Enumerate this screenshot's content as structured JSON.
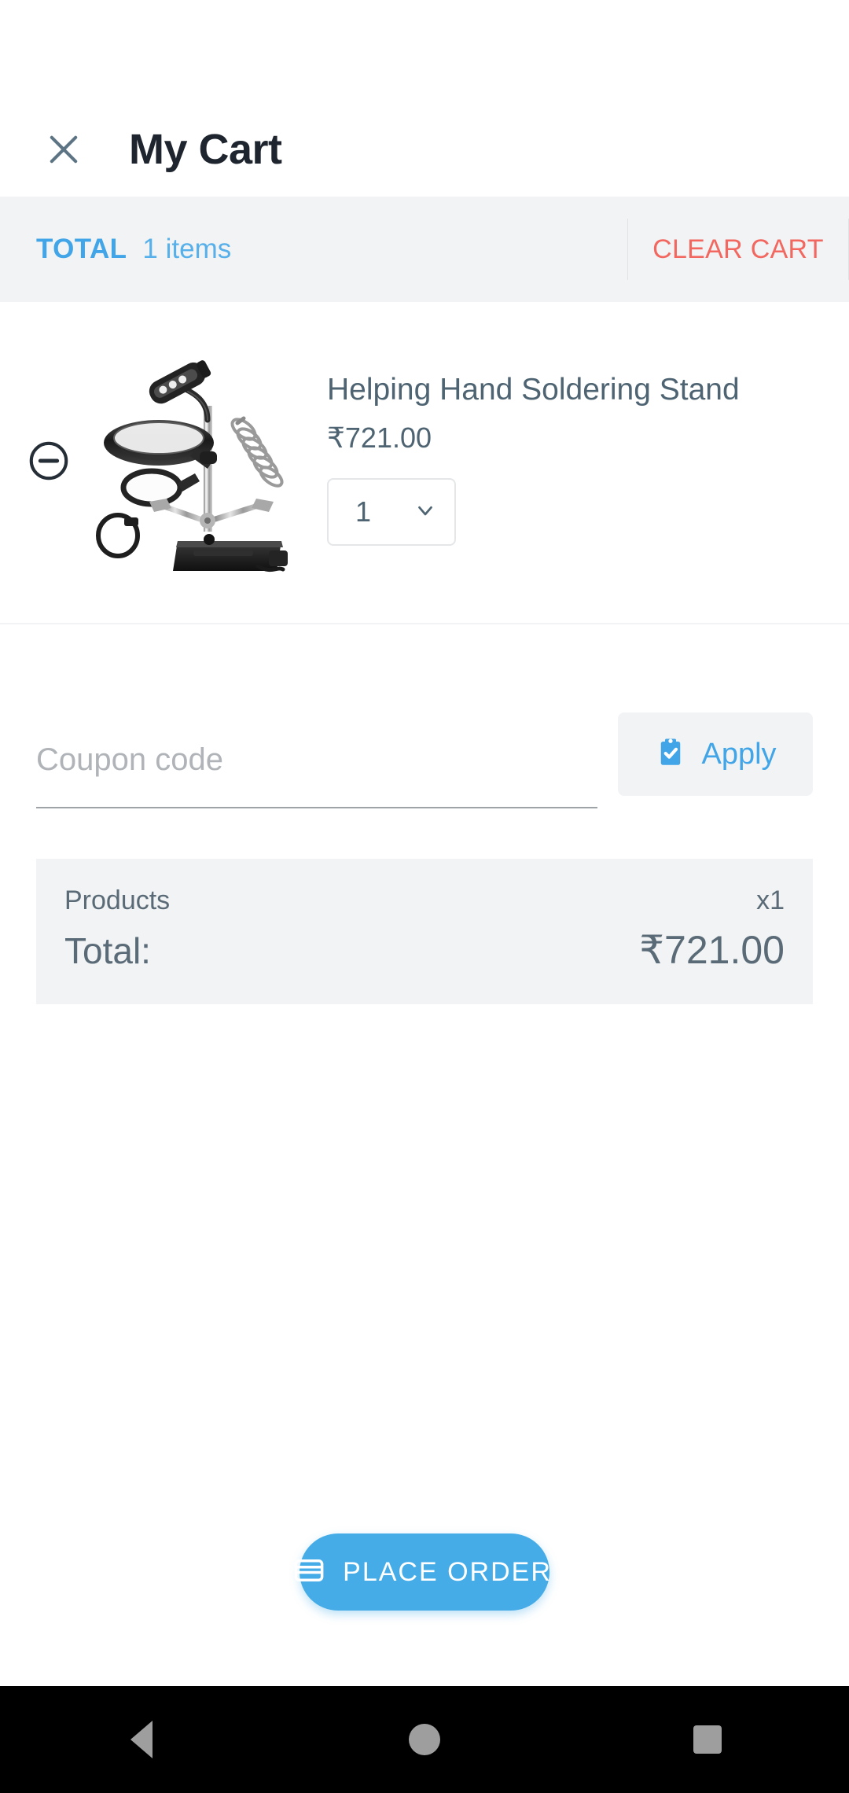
{
  "appbar": {
    "close_icon": "close-icon",
    "title": "My Cart"
  },
  "total_bar": {
    "label": "TOTAL",
    "items_text": "1 items",
    "clear_cart_label": "CLEAR CART",
    "label_color": "#42a5e8",
    "clear_color": "#f2675f",
    "background": "#f1f3f4"
  },
  "cart_items": [
    {
      "remove_icon": "minus-circle-icon",
      "image_alt": "helping-hand-soldering-stand-image",
      "title": "Helping Hand Soldering Stand",
      "price": "₹721.00",
      "quantity": "1",
      "quantity_chevron": "chevron-down-icon"
    }
  ],
  "coupon": {
    "placeholder": "Coupon code",
    "value": "",
    "apply_label": "Apply",
    "apply_icon": "clipboard-check-icon",
    "apply_color": "#42a5e8"
  },
  "summary": {
    "products_label": "Products",
    "products_value": "x1",
    "total_label": "Total:",
    "total_value": "₹721.00",
    "background": "#f1f3f4"
  },
  "place_order": {
    "label": "PLACE ORDER",
    "icon": "credit-card-icon",
    "color": "#45ace8"
  },
  "navbar": {
    "back": "back-triangle-icon",
    "home": "home-circle-icon",
    "recents": "recents-square-icon"
  }
}
